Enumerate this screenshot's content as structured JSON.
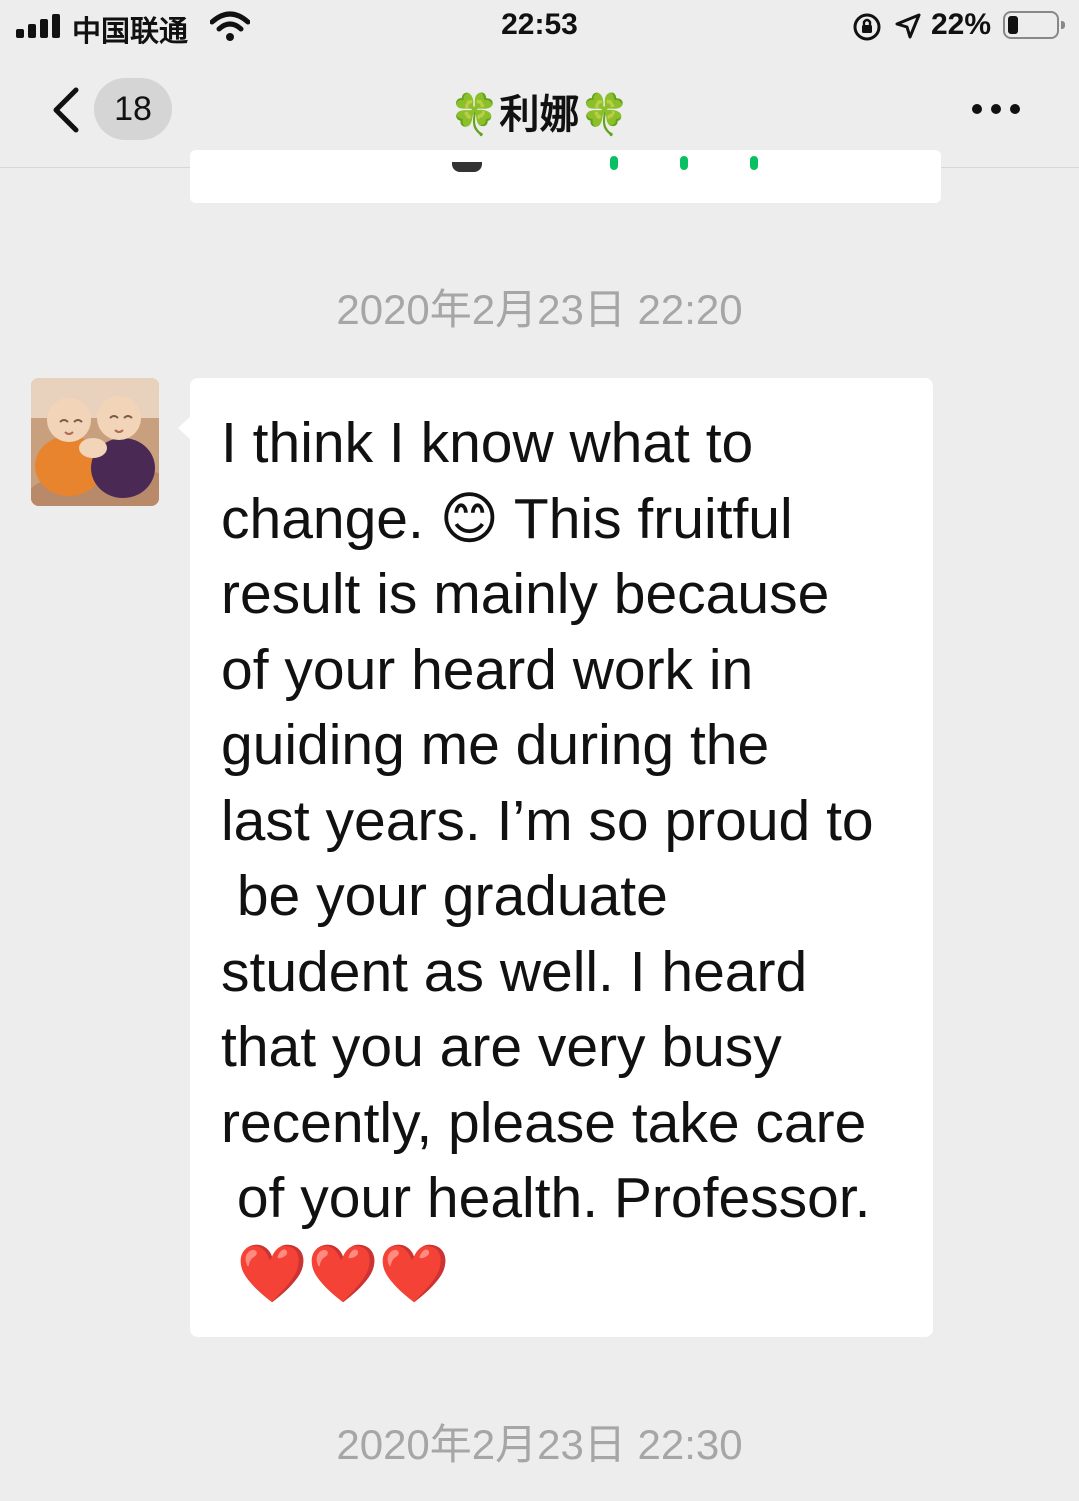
{
  "status_bar": {
    "carrier": "中国联通",
    "time": "22:53",
    "battery_percent": "22%",
    "battery_level": 0.22,
    "icons": [
      "signal-icon",
      "wifi-icon",
      "orientation-lock-icon",
      "location-icon",
      "battery-icon"
    ]
  },
  "nav": {
    "unread_count": "18",
    "title_name": "利娜",
    "clover": "🍀",
    "icons": [
      "back-chevron-icon",
      "more-icon"
    ]
  },
  "chat": {
    "timestamp_1": "2020年2月23日 22:20",
    "message": "I think I know what to\nchange. 😊 This fruitful\nresult is mainly because\nof your heard work in\nguiding me during the\nlast years. I’m so proud to\n be your graduate\nstudent as well. I heard\nthat you are very busy\nrecently, please take care\n of your health. Professor.\n ❤️❤️❤️",
    "timestamp_2": "2020年2月23日 22:30"
  },
  "colors": {
    "background": "#ededed",
    "bubble": "#ffffff",
    "timestamp": "#a6a6a6",
    "link_green": "#07c160"
  }
}
